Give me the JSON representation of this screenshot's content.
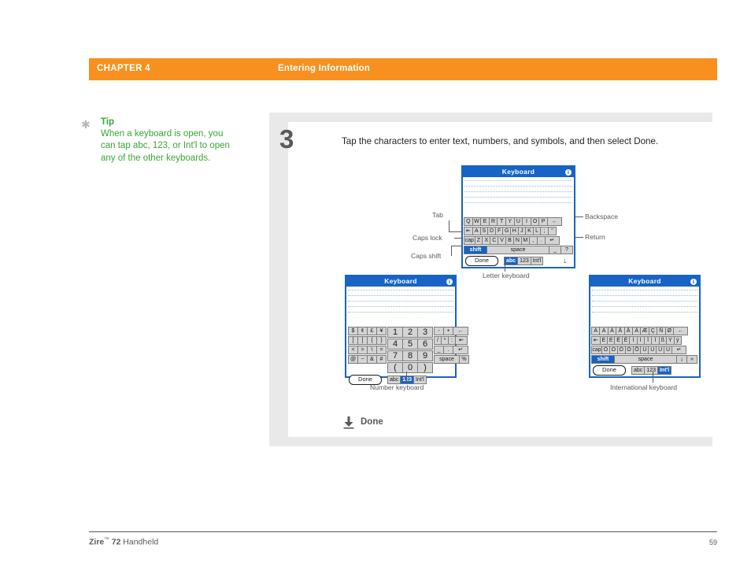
{
  "header": {
    "chapter": "CHAPTER 4",
    "section": "Entering Information"
  },
  "tip": {
    "star_icon": "asterisk-icon",
    "title": "Tip",
    "text": "When a keyboard is open, you can tap abc, 123, or Int'l to open any of the other keyboards.",
    "color": "#3aa635"
  },
  "step": {
    "number": "3",
    "instruction": "Tap the characters to enter text, numbers, and symbols, and then select Done."
  },
  "devices": {
    "letter": {
      "title": "Keyboard",
      "info_icon": "i",
      "rows": [
        [
          "Q",
          "W",
          "E",
          "R",
          "T",
          "Y",
          "U",
          "I",
          "O",
          "P",
          "←"
        ],
        [
          "⇤",
          "A",
          "S",
          "D",
          "F",
          "G",
          "H",
          "J",
          "K",
          "L",
          ";",
          "\""
        ],
        [
          "cap",
          "Z",
          "X",
          "C",
          "V",
          "B",
          "N",
          "M",
          ",",
          ".",
          "↵"
        ],
        [
          "shift",
          "space",
          "_",
          "?"
        ]
      ],
      "bottom": {
        "done": "Done",
        "modes": [
          "abc",
          "123",
          "Int'l"
        ],
        "active_mode": "abc",
        "down_arrow": "↓"
      }
    },
    "number": {
      "title": "Keyboard",
      "info_icon": "i",
      "left_block": [
        [
          "$",
          "¢",
          "£",
          "¥"
        ],
        [
          "[",
          "]",
          "{",
          "}"
        ],
        [
          "<",
          ">",
          "\\",
          "="
        ],
        [
          "@",
          "~",
          "&",
          "#"
        ]
      ],
      "mid_block": [
        [
          "1",
          "2",
          "3"
        ],
        [
          "4",
          "5",
          "6"
        ],
        [
          "7",
          "8",
          "9"
        ],
        [
          "(",
          "0",
          ")"
        ]
      ],
      "right_block": [
        [
          "-",
          "+",
          "←"
        ],
        [
          "/",
          "*",
          ":",
          "⇤"
        ],
        [
          "_",
          ".",
          "↵"
        ],
        [
          "space",
          "%"
        ]
      ],
      "bottom": {
        "done": "Done",
        "modes": [
          "abc",
          "123",
          "Int'l"
        ],
        "active_mode": "123"
      }
    },
    "international": {
      "title": "Keyboard",
      "info_icon": "i",
      "rows": [
        [
          "Á",
          "À",
          "Â",
          "Ã",
          "Å",
          "Ä",
          "Æ",
          "Ç",
          "Ñ",
          "Ø",
          "←"
        ],
        [
          "⇤",
          "É",
          "È",
          "Ê",
          "Ë",
          "Í",
          "Ì",
          "Î",
          "Ï",
          "ß",
          "Ý",
          "ÿ"
        ],
        [
          "cap",
          "Ó",
          "Ò",
          "Ô",
          "Ö",
          "Õ",
          "Ú",
          "Ù",
          "Û",
          "Ü",
          "↵"
        ],
        [
          "shift",
          "space",
          "¡",
          "»"
        ]
      ],
      "bottom": {
        "done": "Done",
        "modes": [
          "abc",
          "123",
          "Int'l"
        ],
        "active_mode": "Int'l"
      }
    }
  },
  "callouts": {
    "tab": "Tab",
    "caps_lock": "Caps lock",
    "caps_shift": "Caps shift",
    "backspace": "Backspace",
    "return": "Return",
    "letter_keyboard": "Letter keyboard",
    "number_keyboard": "Number keyboard",
    "international_keyboard": "International keyboard"
  },
  "done_marker": {
    "icon": "down-arrow-to-bar-icon",
    "label": "Done"
  },
  "footer": {
    "product_bold": "Zire",
    "product_tm": "™",
    "product_model": "72",
    "product_rest": "Handheld",
    "page_number": "59"
  },
  "colors": {
    "header_orange": "#f7901e",
    "tip_green": "#3aa635",
    "device_blue": "#1763c6",
    "panel_gray": "#e9e9e9",
    "text_gray": "#58595b"
  }
}
